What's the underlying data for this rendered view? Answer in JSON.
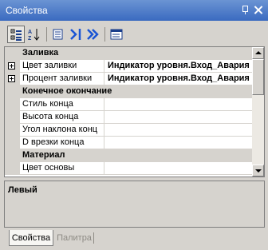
{
  "window": {
    "title": "Свойства"
  },
  "toolbar": {
    "buttons": [
      {
        "icon": "categorized-icon",
        "pressed": true
      },
      {
        "icon": "alphabetical-sort-icon",
        "pressed": false
      },
      {
        "icon": "properties-icon",
        "pressed": false
      },
      {
        "icon": "events-icon",
        "pressed": false
      },
      {
        "icon": "messages-icon",
        "pressed": false
      },
      {
        "icon": "property-pages-icon",
        "pressed": false
      }
    ]
  },
  "grid": {
    "rows": [
      {
        "type": "category",
        "name": "Заливка"
      },
      {
        "type": "property",
        "name": "Цвет заливки",
        "value": "Индикатор уровня.Вход_Авария",
        "expandable": true
      },
      {
        "type": "property",
        "name": "Процент заливки",
        "value": "Индикатор уровня.Вход_Авария",
        "expandable": true
      },
      {
        "type": "category",
        "name": "Конечное окончание"
      },
      {
        "type": "property",
        "name": "Стиль конца",
        "value": ""
      },
      {
        "type": "property",
        "name": "Высота конца",
        "value": ""
      },
      {
        "type": "property",
        "name": "Угол наклона конц",
        "value": ""
      },
      {
        "type": "property",
        "name": "D врезки конца",
        "value": ""
      },
      {
        "type": "category",
        "name": "Материал"
      },
      {
        "type": "property",
        "name": "Цвет основы",
        "value": ""
      }
    ]
  },
  "description": {
    "title": "Левый"
  },
  "tabs": [
    {
      "label": "Свойства",
      "active": true
    },
    {
      "label": "Палитра",
      "active": false
    }
  ]
}
